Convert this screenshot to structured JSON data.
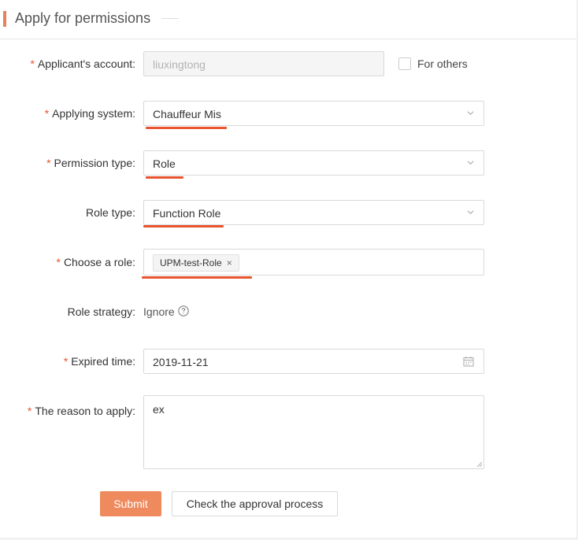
{
  "header": {
    "title": "Apply for permissions"
  },
  "form": {
    "applicant_account": {
      "label": "Applicant's account",
      "value": "liuxingtong",
      "required": "*"
    },
    "for_others": {
      "label": "For others"
    },
    "applying_system": {
      "label": "Applying system",
      "value": "Chauffeur Mis",
      "required": "*"
    },
    "permission_type": {
      "label": "Permission type",
      "value": "Role",
      "required": "*"
    },
    "role_type": {
      "label": "Role type",
      "value": "Function Role"
    },
    "choose_role": {
      "label": "Choose a role",
      "tag": "UPM-test-Role",
      "tag_remove": "×",
      "required": "*"
    },
    "role_strategy": {
      "label": "Role strategy",
      "value": "Ignore"
    },
    "expired_time": {
      "label": "Expired time",
      "value": "2019-11-21",
      "required": "*"
    },
    "reason": {
      "label": "The reason to apply",
      "value": "ex",
      "required": "*"
    },
    "label_suffix": ":"
  },
  "actions": {
    "submit": "Submit",
    "check_process": "Check the approval process"
  },
  "colors": {
    "accent": "#e8825a",
    "required": "#e8542f",
    "annotation_underline": "#e8542f",
    "primary_button": "#ef8a5e"
  }
}
